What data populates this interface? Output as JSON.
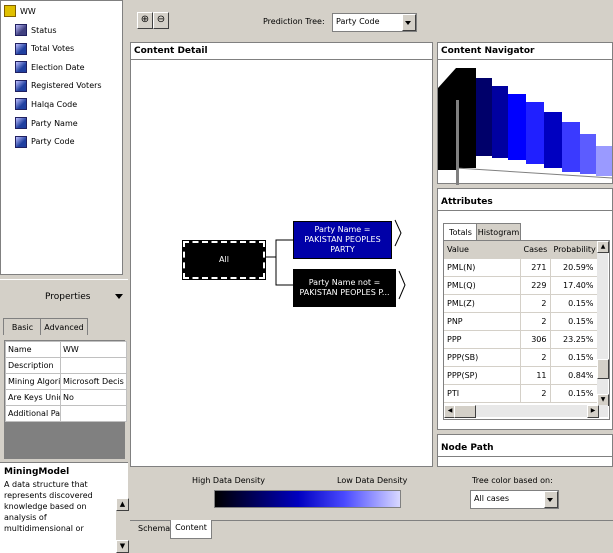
{
  "tree": {
    "root": "WW",
    "items": [
      "Status",
      "Total Votes",
      "Election Date",
      "Registered Voters",
      "Halqa Code",
      "Party Name",
      "Party Code"
    ]
  },
  "properties": {
    "title": "Properties",
    "tabs": [
      "Basic",
      "Advanced"
    ],
    "rows": [
      [
        "Name",
        "WW"
      ],
      [
        "Description",
        ""
      ],
      [
        "Mining Algorith",
        "Microsoft Decis"
      ],
      [
        "Are Keys Uniqu",
        "No"
      ],
      [
        "Additional Parti",
        ""
      ]
    ]
  },
  "help": {
    "title": "MiningModel",
    "text": "A data structure that represents discovered knowledge based on analysis of multidimensional or"
  },
  "toolbar": {
    "zoom_in": "+",
    "zoom_out": "-",
    "prediction_tree_label": "Prediction Tree:",
    "prediction_tree_value": "Party Code"
  },
  "content_detail": {
    "title": "Content Detail",
    "nodes": {
      "root": "All",
      "yes": "Party Name = PAKISTAN PEOPLES PARTY",
      "no": "Party Name not = PAKISTAN PEOPLES P..."
    }
  },
  "navigator": {
    "title": "Content Navigator"
  },
  "attributes": {
    "title": "Attributes",
    "tabs": [
      "Totals",
      "Histogram"
    ],
    "columns": [
      "Value",
      "Cases",
      "Probability"
    ],
    "rows": [
      [
        "PML(N)",
        "271",
        "20.59%"
      ],
      [
        "PML(Q)",
        "229",
        "17.40%"
      ],
      [
        "PML(Z)",
        "2",
        "0.15%"
      ],
      [
        "PNP",
        "2",
        "0.15%"
      ],
      [
        "PPP",
        "306",
        "23.25%"
      ],
      [
        "PPP(SB)",
        "2",
        "0.15%"
      ],
      [
        "PPP(SP)",
        "11",
        "0.84%"
      ],
      [
        "PTI",
        "2",
        "0.15%"
      ]
    ]
  },
  "node_path": {
    "title": "Node Path"
  },
  "legend": {
    "high": "High Data Density",
    "low": "Low Data Density",
    "color_label": "Tree color based on:",
    "color_value": "All cases"
  },
  "bottom_tabs": [
    "Schema",
    "Content"
  ],
  "colors": {
    "node_dark": "#000000",
    "node_blue": "#0000a8",
    "accent": "#0000ff"
  }
}
